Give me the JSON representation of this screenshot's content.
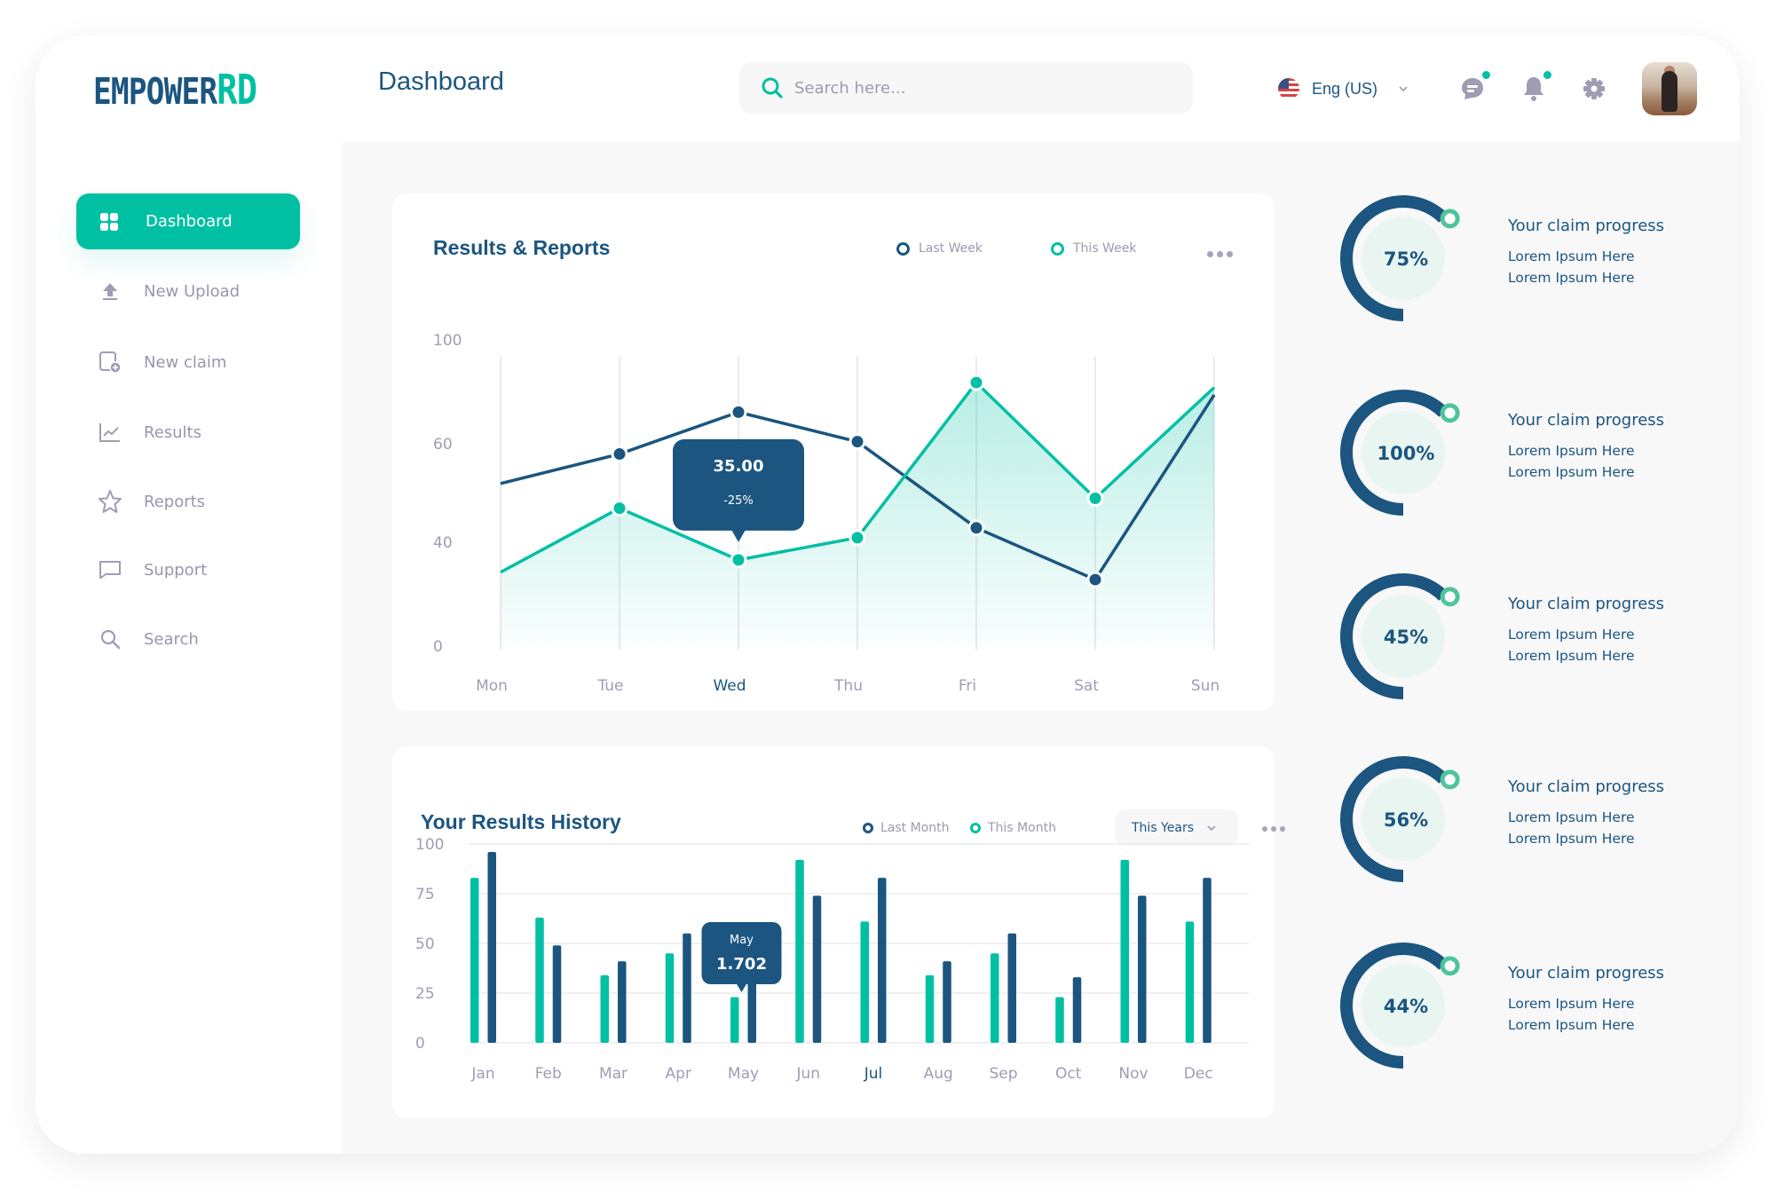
{
  "app": {
    "logo": {
      "part1": "EMPOWER",
      "part2": "RD"
    },
    "page_title": "Dashboard"
  },
  "header": {
    "search": {
      "placeholder": "Search here..."
    },
    "language": {
      "label": "Eng (US)",
      "icon": "us-flag-icon"
    },
    "icons": [
      {
        "name": "chat-icon",
        "has_badge": true
      },
      {
        "name": "bell-icon",
        "has_badge": true
      },
      {
        "name": "gear-icon",
        "has_badge": false
      }
    ],
    "avatar": "user-avatar"
  },
  "sidebar": {
    "items": [
      {
        "label": "Dashboard",
        "icon": "grid-icon",
        "active": true
      },
      {
        "label": "New Upload",
        "icon": "upload-icon",
        "active": false
      },
      {
        "label": "New claim",
        "icon": "new-claim-icon",
        "active": false
      },
      {
        "label": "Results",
        "icon": "line-chart-icon",
        "active": false
      },
      {
        "label": "Reports",
        "icon": "star-icon",
        "active": false
      },
      {
        "label": "Support",
        "icon": "chat-bubble-icon",
        "active": false
      },
      {
        "label": "Search",
        "icon": "search-icon",
        "active": false
      }
    ]
  },
  "colors": {
    "primary": "#1b5580",
    "accent": "#00c0a3",
    "muted": "#9e9aae",
    "ring_knob": "#4fc49b",
    "inner_circle": "#e9f5f1"
  },
  "results_card": {
    "title": "Results & Reports",
    "legend": [
      "Last Week",
      "This Week"
    ],
    "tooltip": {
      "value": "35.00",
      "change": "-25%",
      "category": "Wed",
      "series": "This Week"
    },
    "highlighted_category": "Wed"
  },
  "history_card": {
    "title": "Your Results History",
    "legend": [
      "Last Month",
      "This Month"
    ],
    "dropdown": "This Years",
    "tooltip": {
      "label": "May",
      "value": "1.702",
      "category": "May"
    },
    "highlighted_category": "Jul"
  },
  "chart_data": [
    {
      "type": "area",
      "title": "Results & Reports",
      "xlabel": "",
      "ylabel": "",
      "categories": [
        "Mon",
        "Tue",
        "Wed",
        "Thu",
        "Fri",
        "Sat",
        "Sun"
      ],
      "yticks": [
        0,
        40,
        60,
        100
      ],
      "ylim": [
        0,
        100
      ],
      "grid": "vertical",
      "legend_position": "top-right",
      "series": [
        {
          "name": "Last Week",
          "style": "line",
          "color": "#1b5580",
          "values": [
            53,
            59,
            75,
            63,
            44,
            27,
            82
          ]
        },
        {
          "name": "This Week",
          "style": "area",
          "color": "#00c0a3",
          "values": [
            30,
            48,
            35,
            42,
            87,
            50,
            85
          ]
        }
      ],
      "annotations": [
        {
          "category": "Wed",
          "series": "This Week",
          "text": "35.00",
          "subtext": "-25%"
        }
      ]
    },
    {
      "type": "bar",
      "title": "Your Results History",
      "xlabel": "",
      "ylabel": "",
      "categories": [
        "Jan",
        "Feb",
        "Mar",
        "Apr",
        "May",
        "Jun",
        "Jul",
        "Aug",
        "Sep",
        "Oct",
        "Nov",
        "Dec"
      ],
      "yticks": [
        0,
        25,
        50,
        75,
        100
      ],
      "ylim": [
        0,
        100
      ],
      "grid": "horizontal",
      "legend_position": "top-right",
      "series": [
        {
          "name": "This Month",
          "color": "#00c0a3",
          "values": [
            83,
            63,
            34,
            45,
            23,
            92,
            61,
            34,
            45,
            23,
            92,
            61
          ]
        },
        {
          "name": "Last Month",
          "color": "#1b5580",
          "values": [
            96,
            49,
            41,
            55,
            33,
            74,
            83,
            41,
            55,
            33,
            74,
            83
          ]
        }
      ],
      "annotations": [
        {
          "category": "May",
          "text": "May",
          "subtext": "1.702"
        }
      ]
    }
  ],
  "progress_cards": [
    {
      "percent": 75,
      "label": "75%",
      "title": "Your claim progress",
      "line1": "Lorem Ipsum Here",
      "line2": "Lorem Ipsum Here"
    },
    {
      "percent": 100,
      "label": "100%",
      "title": "Your claim progress",
      "line1": "Lorem Ipsum Here",
      "line2": "Lorem Ipsum Here"
    },
    {
      "percent": 45,
      "label": "45%",
      "title": "Your claim progress",
      "line1": "Lorem Ipsum Here",
      "line2": "Lorem Ipsum Here"
    },
    {
      "percent": 56,
      "label": "56%",
      "title": "Your claim progress",
      "line1": "Lorem Ipsum Here",
      "line2": "Lorem Ipsum Here"
    },
    {
      "percent": 44,
      "label": "44%",
      "title": "Your claim progress",
      "line1": "Lorem Ipsum Here",
      "line2": "Lorem Ipsum Here"
    }
  ]
}
